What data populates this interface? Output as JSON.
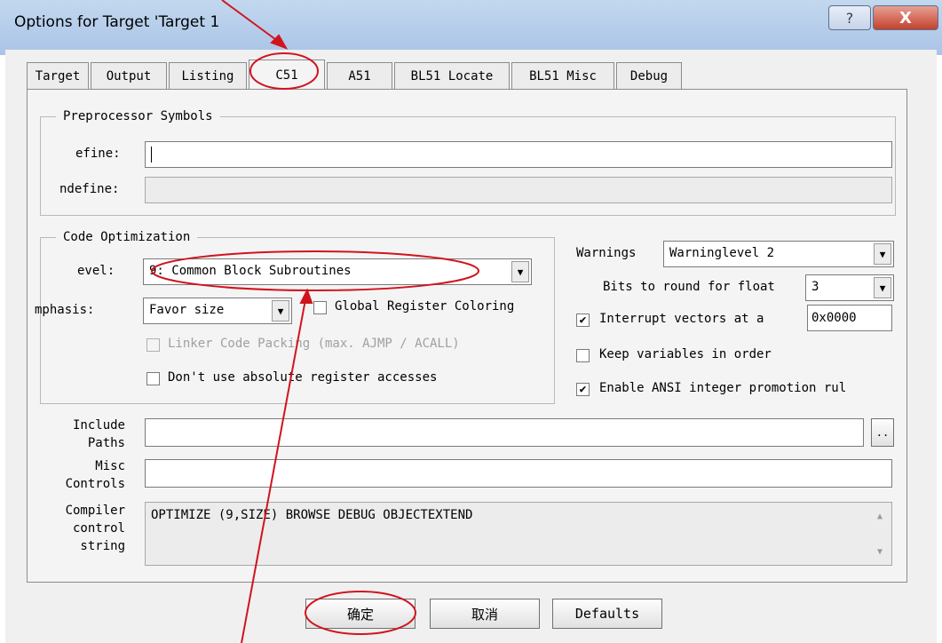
{
  "window": {
    "title": "Options for Target 'Target 1",
    "help_symbol": "?",
    "close_symbol": "X"
  },
  "tabs": [
    {
      "label": "Target"
    },
    {
      "label": "Output"
    },
    {
      "label": "Listing"
    },
    {
      "label": "C51",
      "active": true
    },
    {
      "label": "A51"
    },
    {
      "label": "BL51 Locate"
    },
    {
      "label": "BL51 Misc"
    },
    {
      "label": "Debug"
    }
  ],
  "preprocessor": {
    "group_title": "Preprocessor Symbols",
    "define_label": "efine:",
    "define_value": "",
    "undefine_label": "ndefine:",
    "undefine_value": ""
  },
  "code_optimization": {
    "group_title": "Code Optimization",
    "level_label": "evel:",
    "level_value": "9: Common Block Subroutines",
    "emphasis_label": "mphasis:",
    "emphasis_value": "Favor size",
    "global_register_coloring": {
      "label": "Global Register Coloring",
      "checked": false
    },
    "linker_code_packing": {
      "label": "Linker Code Packing (max. AJMP / ACALL)",
      "checked": false,
      "disabled": true
    },
    "dont_use_absolute": {
      "label": "Don't use absolute register accesses",
      "checked": false
    }
  },
  "warnings": {
    "label": "Warnings",
    "value": "Warninglevel 2"
  },
  "bits_round": {
    "label": "Bits to round for float",
    "value": "3"
  },
  "interrupt_vectors": {
    "label": "Interrupt vectors at a",
    "checked": true,
    "value": "0x0000"
  },
  "keep_variables": {
    "label": "Keep variables in order",
    "checked": false
  },
  "ansi_promotion": {
    "label": "Enable ANSI integer promotion rul",
    "checked": true
  },
  "include_paths": {
    "label_line1": "Include",
    "label_line2": "Paths",
    "value": "",
    "browse_label": ".."
  },
  "misc_controls": {
    "label_line1": "Misc",
    "label_line2": "Controls",
    "value": ""
  },
  "compiler_control": {
    "label_line1": "Compiler",
    "label_line2": "control",
    "label_line3": "string",
    "value": "OPTIMIZE (9,SIZE) BROWSE DEBUG OBJECTEXTEND"
  },
  "buttons": {
    "ok": "确定",
    "cancel": "取消",
    "defaults": "Defaults"
  },
  "icons": {
    "check": "✔",
    "dropdown": "▼",
    "scroll_up": "▲",
    "scroll_down": "▼"
  },
  "annotation_color": "#d0141e"
}
